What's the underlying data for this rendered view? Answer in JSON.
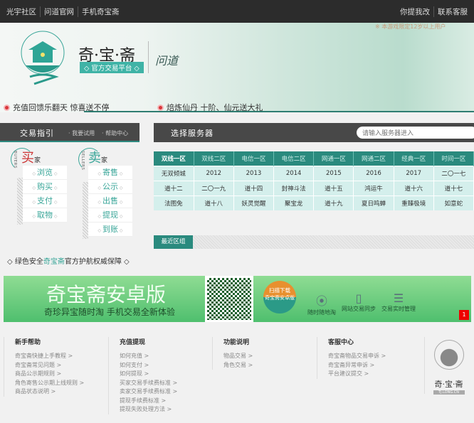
{
  "topbar": {
    "left": [
      "光宇社区",
      "问道官网",
      "手机奇宝斋"
    ],
    "right": [
      "你提我改",
      "联系客服"
    ]
  },
  "header": {
    "brand": "奇·宝·斋",
    "subtitle": "◇ 官方交易平台 ◇",
    "game": "问道",
    "age_notice": "※ 本游戏限定12岁以上用户"
  },
  "notices": [
    "充值回馈乐翻天 惊喜送不停",
    "焙炼仙丹 十阶、仙元送大礼"
  ],
  "guide": {
    "title": "交易指引",
    "links": [
      "· 我要试用",
      "· 帮助中心"
    ]
  },
  "buyers": {
    "char": "买",
    "suffix": "家",
    "en": "BUYERS",
    "items": [
      "浏览",
      "购买",
      "支付",
      "取物"
    ]
  },
  "sellers": {
    "char": "卖",
    "suffix": "家",
    "en": "SELLERS",
    "items": [
      "寄售",
      "公示",
      "出售",
      "提现",
      "到账"
    ]
  },
  "servers": {
    "title": "选择服务器",
    "search_placeholder": "请输入服务器进入",
    "tabs": [
      "双线一区",
      "双线二区",
      "电信一区",
      "电信二区",
      "网通一区",
      "网通二区",
      "经典一区",
      "时间一区"
    ],
    "rows": [
      [
        "无双倾城",
        "2012",
        "2013",
        "2014",
        "2015",
        "2016",
        "2017",
        "二〇一七"
      ],
      [
        "道十二",
        "二〇一九",
        "道十四",
        "封神斗法",
        "道十五",
        "鸿运牛",
        "道十六",
        "道十七"
      ],
      [
        "法图免",
        "道十八",
        "妖灵觉醒",
        "聚宝龙",
        "道十九",
        "夏日鸣蝉",
        "重臻极境",
        "如意蛇"
      ]
    ],
    "recent": "最近区组"
  },
  "guarantee": {
    "pre": "◇ 绿色安全",
    "brand": "奇宝斋",
    "post": "官方护航权威保障 ◇"
  },
  "banner": {
    "title": "奇宝斋安卓版",
    "subtitle": "奇珍异宝随时淘 手机交易全新体验",
    "scan": "扫描下载",
    "scan_sub": "奇宝斋安卓版",
    "features": [
      "随时随地淘",
      "网站交易同步",
      "交易实时管理"
    ],
    "page": "1"
  },
  "footer": {
    "columns": [
      {
        "title": "新手帮助",
        "links": [
          "奇宝斋快捷上手教程 >",
          "奇宝斋常见问题 >",
          "商品公示期规则 >",
          "角色寄售公示期上线规则 >",
          "商品状态说明 >"
        ]
      },
      {
        "title": "充值提现",
        "links": [
          "如何充值 >",
          "如何支付 >",
          "如何提现 >",
          "买家交易手续费标准 >",
          "卖家交易手续费标准 >",
          "提现手续费标准 >",
          "提现失败处理方法 >"
        ]
      },
      {
        "title": "功能说明",
        "links": [
          "物品交易 >",
          "角色交易 >"
        ]
      },
      {
        "title": "客服中心",
        "links": [
          "奇宝斋物品交易申诉 >",
          "奇宝斋异常申诉 >",
          "平台建议提交 >"
        ]
      }
    ],
    "logo": "奇·宝·斋",
    "logo_url": "TJ.LONG.CN"
  }
}
